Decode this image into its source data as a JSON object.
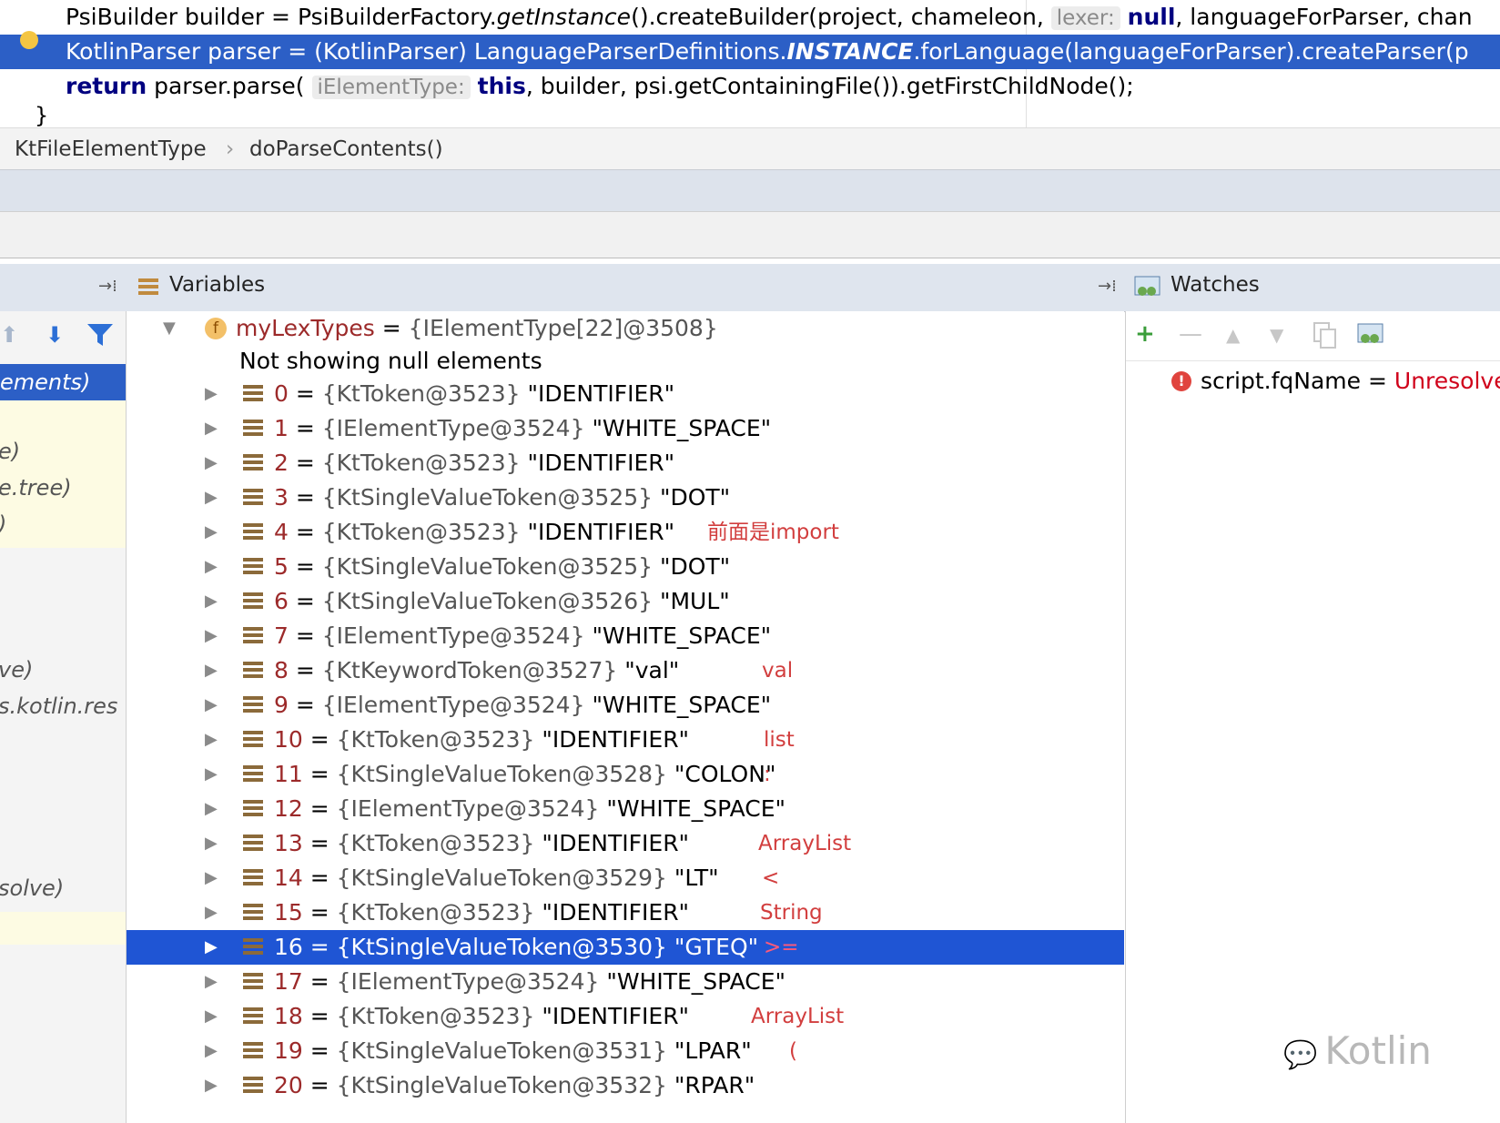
{
  "editor": {
    "line1": {
      "pre": "PsiBuilder builder = PsiBuilderFactory.",
      "italic": "getInstance",
      "mid": "().createBuilder(project, chameleon, ",
      "hint": "lexer:",
      "kw": "null",
      "post": ", languageForParser, chan"
    },
    "line2": {
      "pre": "KotlinParser parser = (KotlinParser) LanguageParserDefinitions.",
      "italic": "INSTANCE",
      "post": ".forLanguage(languageForParser).createParser(p"
    },
    "line3": {
      "kw": "return",
      "mid": " parser.parse( ",
      "hint": "iElementType:",
      "kw2": "this",
      "post": ", builder, psi.getContainingFile()).getFirstChildNode();"
    },
    "line4": "}"
  },
  "breadcrumb": {
    "class": "KtFileElementType",
    "sep": "›",
    "method": "doParseContents()"
  },
  "variables_panel": {
    "title": "Variables",
    "pin": "→⁞"
  },
  "watches_panel": {
    "title": "Watches",
    "pin": "→⁞"
  },
  "frames": {
    "selected": "ements)",
    "items": [
      {
        "text": "e)",
        "row": 0
      },
      {
        "text": "e.tree)",
        "row": 1
      },
      {
        "text": ")",
        "row": 2
      },
      {
        "text": "ve)",
        "row": 3
      },
      {
        "text": "s.kotlin.res",
        "row": 4
      },
      {
        "text": "solve)",
        "row": 5
      }
    ]
  },
  "root": {
    "name": "myLexTypes",
    "eq": " = ",
    "value": "{IElementType[22]@3508}",
    "badge": "f"
  },
  "info": "Not showing null elements",
  "rows": [
    {
      "index": "0",
      "type": "{KtToken@3523}",
      "value": "\"IDENTIFIER\"",
      "note": ""
    },
    {
      "index": "1",
      "type": "{IElementType@3524}",
      "value": "\"WHITE_SPACE\"",
      "note": ""
    },
    {
      "index": "2",
      "type": "{KtToken@3523}",
      "value": "\"IDENTIFIER\"",
      "note": ""
    },
    {
      "index": "3",
      "type": "{KtSingleValueToken@3525}",
      "value": "\"DOT\"",
      "note": ""
    },
    {
      "index": "4",
      "type": "{KtToken@3523}",
      "value": "\"IDENTIFIER\"",
      "note": "前面是import"
    },
    {
      "index": "5",
      "type": "{KtSingleValueToken@3525}",
      "value": "\"DOT\"",
      "note": ""
    },
    {
      "index": "6",
      "type": "{KtSingleValueToken@3526}",
      "value": "\"MUL\"",
      "note": ""
    },
    {
      "index": "7",
      "type": "{IElementType@3524}",
      "value": "\"WHITE_SPACE\"",
      "note": ""
    },
    {
      "index": "8",
      "type": "{KtKeywordToken@3527}",
      "value": "\"val\"",
      "note": "val"
    },
    {
      "index": "9",
      "type": "{IElementType@3524}",
      "value": "\"WHITE_SPACE\"",
      "note": ""
    },
    {
      "index": "10",
      "type": "{KtToken@3523}",
      "value": "\"IDENTIFIER\"",
      "note": "list"
    },
    {
      "index": "11",
      "type": "{KtSingleValueToken@3528}",
      "value": "\"COLON\"",
      "note": ":"
    },
    {
      "index": "12",
      "type": "{IElementType@3524}",
      "value": "\"WHITE_SPACE\"",
      "note": ""
    },
    {
      "index": "13",
      "type": "{KtToken@3523}",
      "value": "\"IDENTIFIER\"",
      "note": "ArrayList"
    },
    {
      "index": "14",
      "type": "{KtSingleValueToken@3529}",
      "value": "\"LT\"",
      "note": "<"
    },
    {
      "index": "15",
      "type": "{KtToken@3523}",
      "value": "\"IDENTIFIER\"",
      "note": "String"
    },
    {
      "index": "16",
      "type": "{KtSingleValueToken@3530}",
      "value": "\"GTEQ\"",
      "note": ">="
    },
    {
      "index": "17",
      "type": "{IElementType@3524}",
      "value": "\"WHITE_SPACE\"",
      "note": ""
    },
    {
      "index": "18",
      "type": "{KtToken@3523}",
      "value": "\"IDENTIFIER\"",
      "note": "ArrayList"
    },
    {
      "index": "19",
      "type": "{KtSingleValueToken@3531}",
      "value": "\"LPAR\"",
      "note": "("
    },
    {
      "index": "20",
      "type": "{KtSingleValueToken@3532}",
      "value": "\"RPAR\"",
      "note": ""
    }
  ],
  "selected_row": 16,
  "watch": {
    "name": "script.fqName",
    "eq": " = ",
    "value": "Unresolve"
  },
  "watermark": "Kotlin",
  "colors": {
    "selection": "#1f55d4",
    "note": "#d23e3e",
    "error": "#e0443e"
  }
}
